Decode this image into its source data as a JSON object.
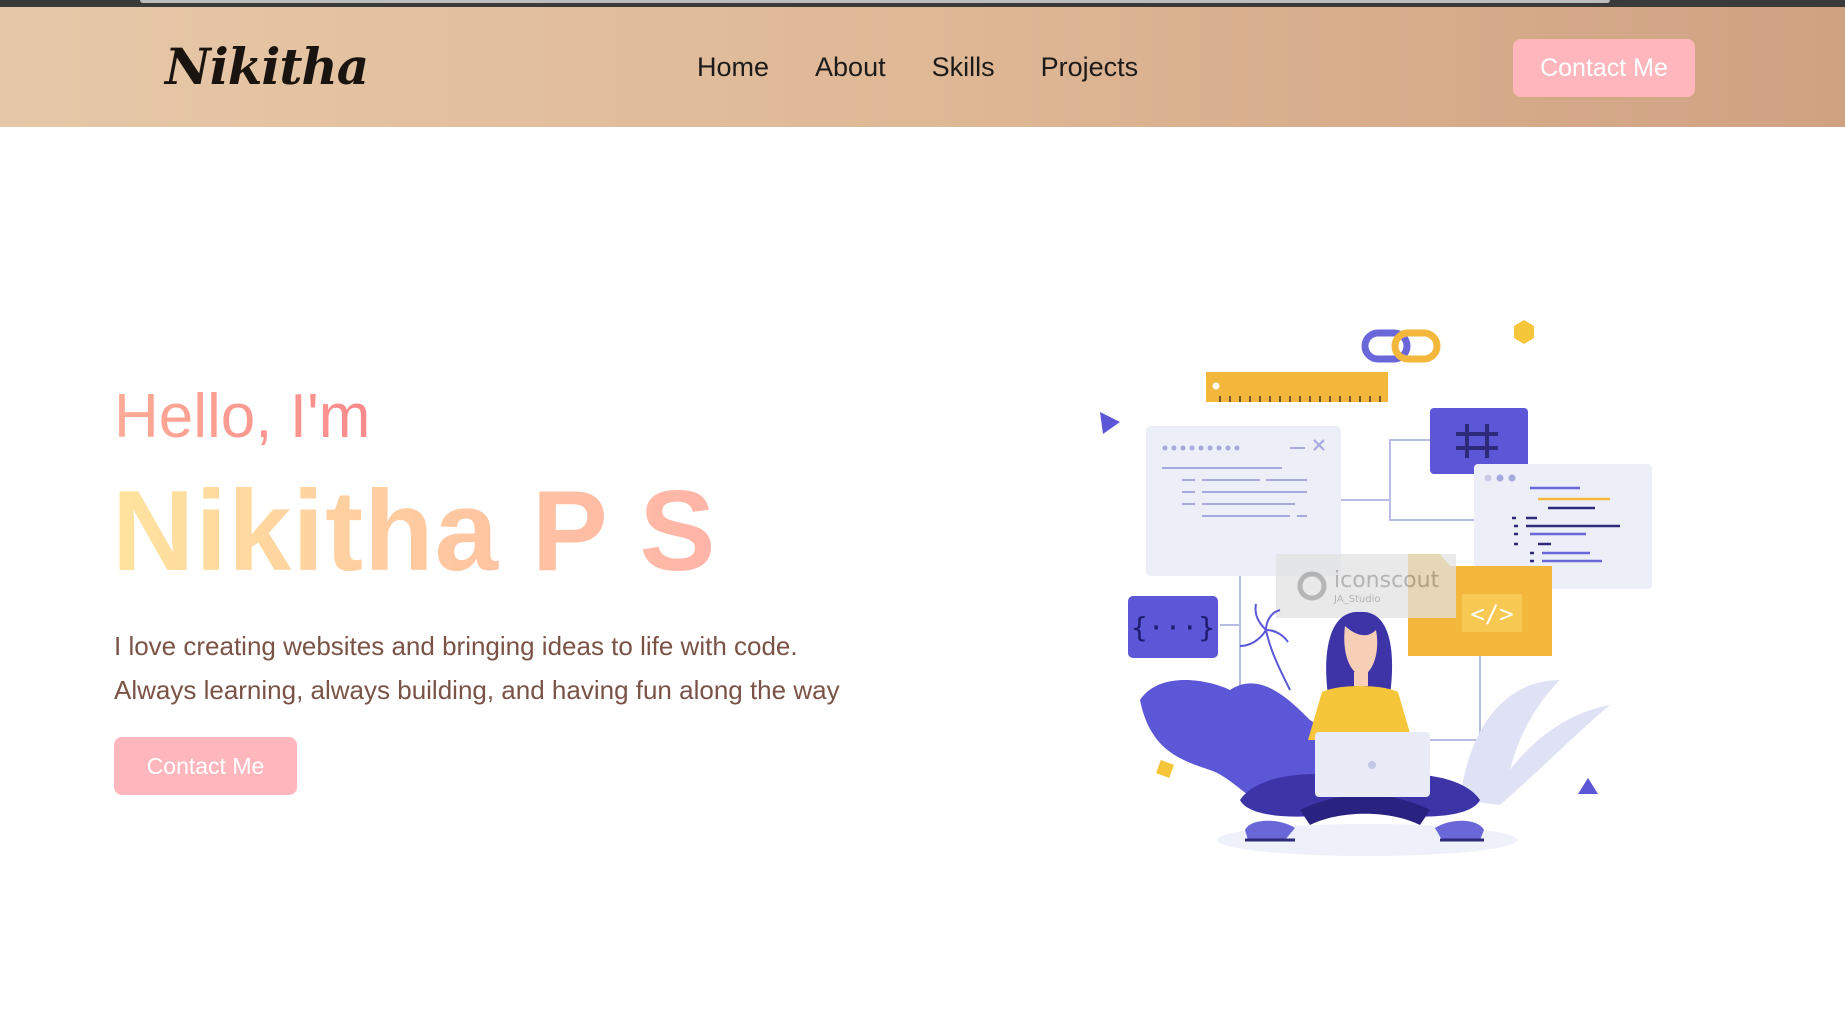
{
  "header": {
    "logo": "Nikitha",
    "nav": [
      "Home",
      "About",
      "Skills",
      "Projects"
    ],
    "contact_label": "Contact Me"
  },
  "hero": {
    "greeting": "Hello, I'm",
    "name": "Nikitha P S",
    "description_line1": "I love creating websites and bringing ideas to life with code.",
    "description_line2": "Always learning, always building, and having fun along the way",
    "contact_label": "Contact Me"
  },
  "illustration": {
    "watermark_brand": "iconscout",
    "watermark_author": "JA_Studio"
  },
  "colors": {
    "accent_button": "#ffb6bd",
    "header_gradient_start": "#e6c8a8",
    "header_gradient_end": "#cfa282",
    "text_description": "#7a5346"
  }
}
